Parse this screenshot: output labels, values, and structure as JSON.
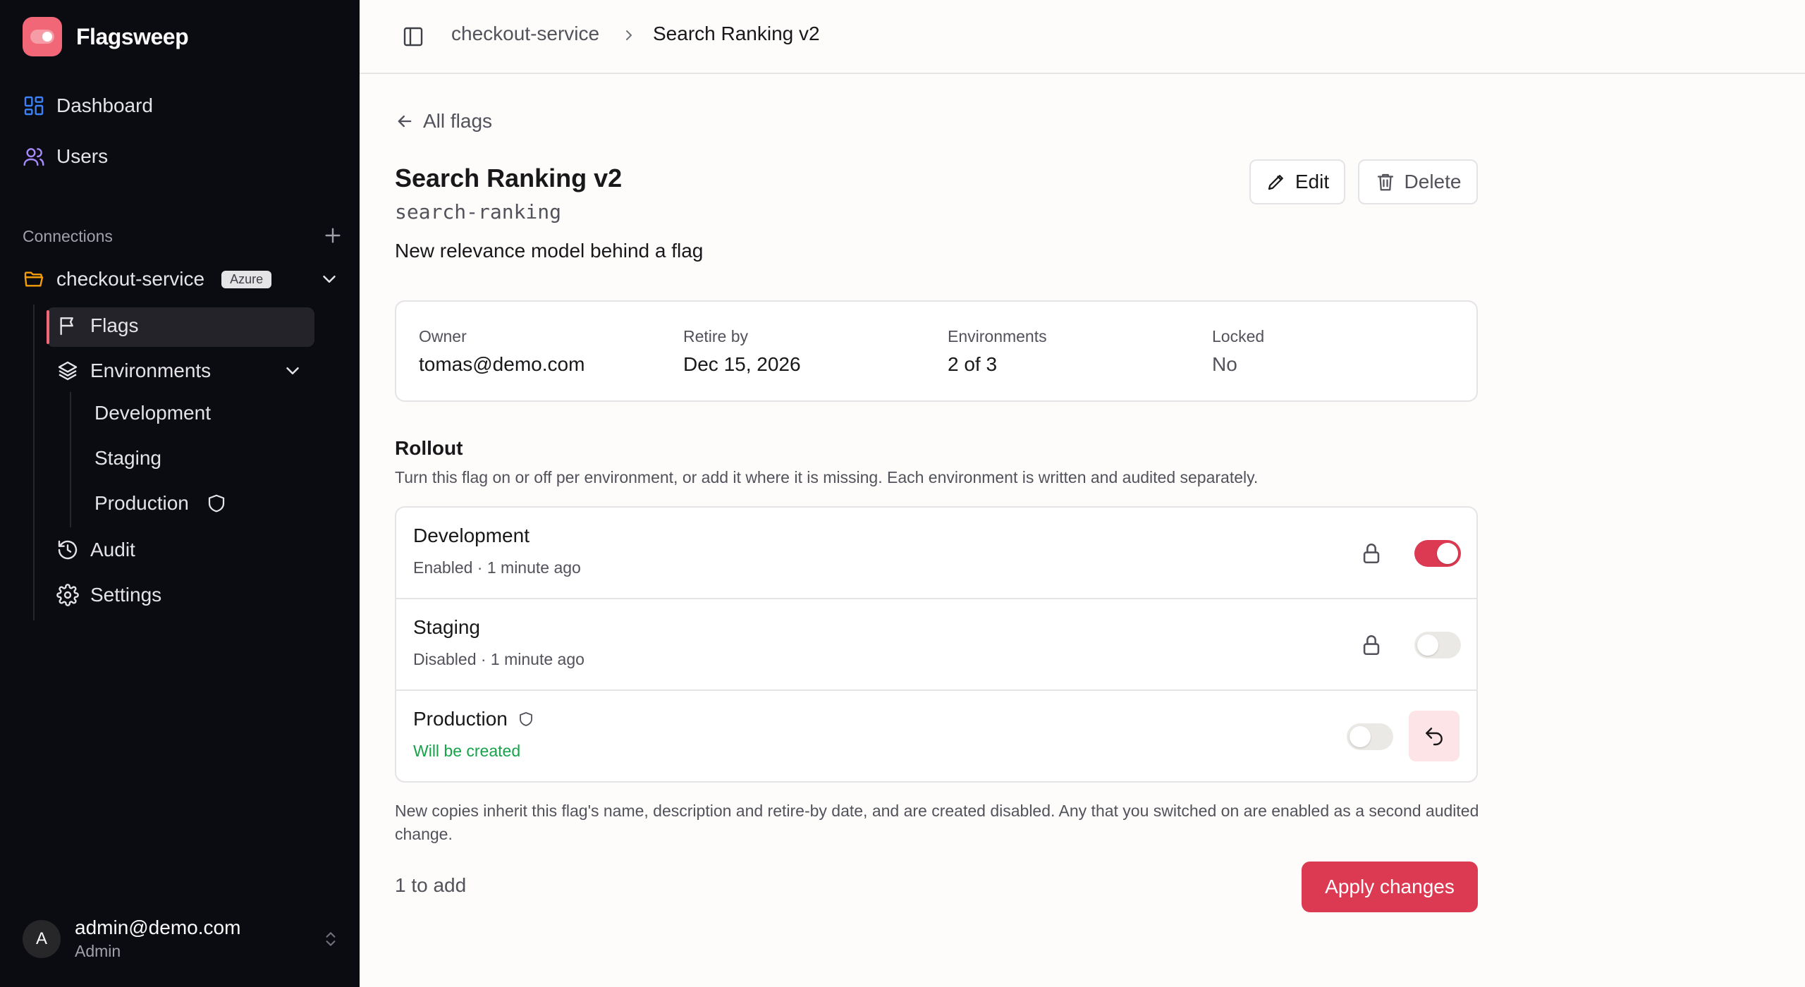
{
  "app": {
    "name": "Flagsweep"
  },
  "sidebar": {
    "nav": [
      {
        "label": "Dashboard",
        "icon": "dashboard-icon"
      },
      {
        "label": "Users",
        "icon": "users-icon"
      }
    ],
    "connections_label": "Connections",
    "connection": {
      "name": "checkout-service",
      "badge": "Azure",
      "items": {
        "flags": "Flags",
        "environments": "Environments",
        "environment_list": [
          "Development",
          "Staging",
          "Production"
        ],
        "audit": "Audit",
        "settings": "Settings"
      }
    },
    "user": {
      "initial": "A",
      "email": "admin@demo.com",
      "role": "Admin"
    }
  },
  "breadcrumb": {
    "parent": "checkout-service",
    "current": "Search Ranking v2"
  },
  "flag": {
    "back_label": "All flags",
    "title": "Search Ranking v2",
    "key": "search-ranking",
    "description": "New relevance model behind a flag",
    "edit_label": "Edit",
    "delete_label": "Delete",
    "meta": {
      "owner_label": "Owner",
      "owner": "tomas@demo.com",
      "retire_label": "Retire by",
      "retire": "Dec 15, 2026",
      "envs_label": "Environments",
      "envs": "2 of 3",
      "locked_label": "Locked",
      "locked": "No"
    }
  },
  "rollout": {
    "title": "Rollout",
    "subtitle": "Turn this flag on or off per environment, or add it where it is missing. Each environment is written and audited separately.",
    "environments": [
      {
        "name": "Development",
        "status": "Enabled · 1 minute ago",
        "enabled": true
      },
      {
        "name": "Staging",
        "status": "Disabled · 1 minute ago",
        "enabled": false
      },
      {
        "name": "Production",
        "status": "Will be created",
        "enabled": false
      }
    ],
    "footnote": "New copies inherit this flag's name, description and retire-by date, and are created disabled. Any that you switched on are enabled as a second audited change.",
    "pending": "1 to add",
    "apply_label": "Apply changes"
  },
  "colors": {
    "accent": "#dc3a52",
    "brand": "#f26778",
    "sidebar_bg": "#0b0b12",
    "success": "#16a34a",
    "folder": "#f59e0b",
    "dashboard_icon": "#3b82f6",
    "users_icon": "#a78bfa"
  }
}
